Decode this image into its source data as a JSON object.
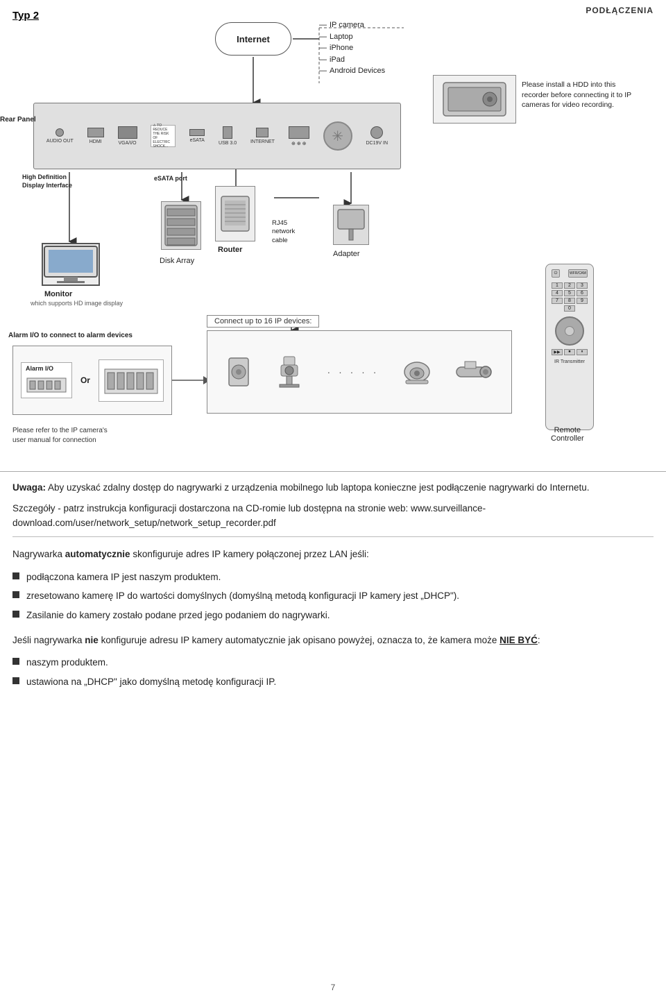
{
  "header": {
    "title": "PODŁĄCZENIA"
  },
  "diagram": {
    "typ_label": "Typ 2",
    "internet_label": "Internet",
    "device_list": [
      "IP camera",
      "Laptop",
      "iPhone",
      "iPad",
      "Android Devices"
    ],
    "rear_panel_label": "Rear Panel",
    "hdd_note": "Please install a HDD into this recorder before connecting it to IP cameras for video recording.",
    "hdmi_label": "High Definition\nDisplay Interface",
    "esata_label": "eSATA port",
    "router_label": "Router",
    "rj45_label": "RJ45\nnetwork\ncable",
    "disk_array_label": "Disk Array",
    "adapter_label": "Adapter",
    "monitor_label": "Monitor",
    "monitor_sublabel": "which supports HD image display",
    "connect_label": "Connect up to 16 IP devices:",
    "alarm_label": "Alarm I/O to connect to alarm devices",
    "alarm_inner_label": "Alarm I/O",
    "or_label": "Or",
    "refer_text": "Please refer to the IP camera's\nuser manual for connection",
    "remote_label": "Remote\nController",
    "ir_label": "IR Transmitter"
  },
  "text_content": {
    "uwaga_bold": "Uwaga:",
    "uwaga_text": " Aby uzyskać zdalny dostęp do nagrywarki z urządzenia mobilnego lub laptopa konieczne jest podłączenie nagrywarki do Internetu.",
    "szczegoły_text": "Szczegóły - patrz instrukcja konfiguracji dostarczona na CD-romie lub dostępna na stronie web: ",
    "url_text": "www.surveillance-download.com/user/network_setup/network_setup_recorder.pdf",
    "auto_text_pre": "Nagrywarka ",
    "auto_bold": "automatycznie",
    "auto_text_post": " skonfiguruje adres IP kamery połączonej przez LAN jeśli:",
    "bullets": [
      "podłączona kamera IP jest naszym produktem.",
      "zresetowano kamerę IP do wartości domyślnych (domyślną metodą konfiguracji IP kamery jest „DHCP\").",
      "Zasilanie do kamery zostało podane przed jego podaniem do nagrywarki."
    ],
    "jesli_pre": "Jeśli nagrywarka ",
    "jesli_bold": "nie",
    "jesli_mid": " konfiguruje adresu IP kamery automatycznie jak opisano powyżej, oznacza to, że kamera może ",
    "nie_byc_bold": "NIE BYĆ",
    "jesli_end": ":",
    "bullets2": [
      "naszym produktem.",
      "ustawiona na „DHCP\" jako domyślną metodę konfiguracji IP."
    ]
  },
  "page_number": "7"
}
